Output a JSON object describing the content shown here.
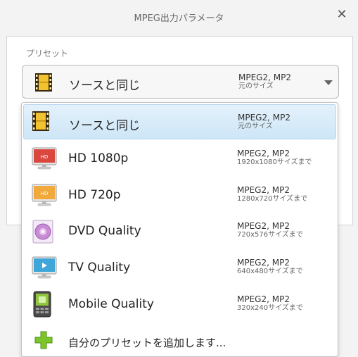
{
  "window": {
    "title": "MPEG出力パラメータ"
  },
  "panel": {
    "label": "プリセット"
  },
  "selected": {
    "name": "ソースと同じ",
    "codec": "MPEG2, MP2",
    "size": "元のサイズ"
  },
  "items": [
    {
      "name": "ソースと同じ",
      "codec": "MPEG2, MP2",
      "size": "元のサイズ",
      "icon": "film-icon"
    },
    {
      "name": "HD 1080p",
      "codec": "MPEG2, MP2",
      "size": "1920x1080サイズまで",
      "icon": "hd-monitor-red-icon"
    },
    {
      "name": "HD 720p",
      "codec": "MPEG2, MP2",
      "size": "1280x720サイズまで",
      "icon": "hd-monitor-orange-icon"
    },
    {
      "name": "DVD Quality",
      "codec": "MPEG2, MP2",
      "size": "720x576サイズまで",
      "icon": "dvd-disc-icon"
    },
    {
      "name": "TV Quality",
      "codec": "MPEG2, MP2",
      "size": "640x480サイズまで",
      "icon": "tv-icon"
    },
    {
      "name": "Mobile Quality",
      "codec": "MPEG2, MP2",
      "size": "320x240サイズまで",
      "icon": "mobile-phone-icon"
    }
  ],
  "add_preset": {
    "label": "自分のプリセットを追加します...",
    "icon": "plus-icon"
  },
  "colors": {
    "selection": "#cde6f7",
    "plus": "#7cc52a",
    "hd1080": "#d9473f",
    "hd720": "#f0a93a"
  }
}
